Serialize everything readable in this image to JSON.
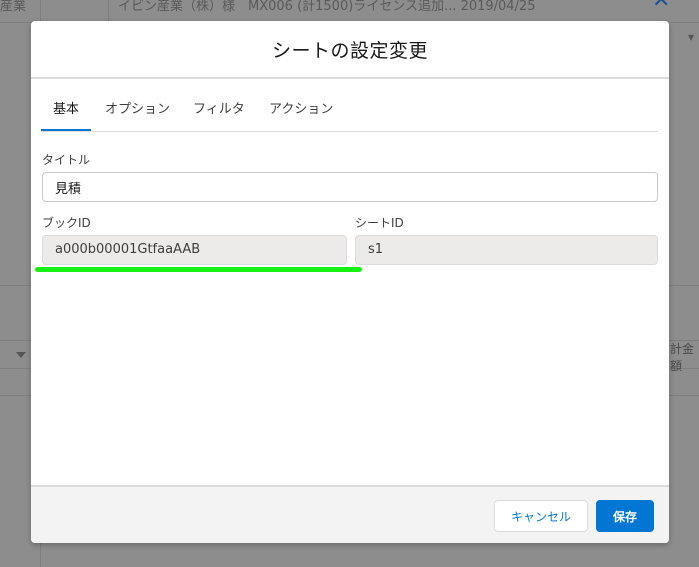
{
  "background": {
    "left_text": "産業",
    "record_text": "イビン産業（株）様　MX006 (計1500)ライセンス追加...  2019/04/25",
    "right_text": "計金額",
    "close_icon": "close-icon"
  },
  "modal": {
    "title": "シートの設定変更",
    "tabs": [
      {
        "label": "基本",
        "active": true
      },
      {
        "label": "オプション",
        "active": false
      },
      {
        "label": "フィルタ",
        "active": false
      },
      {
        "label": "アクション",
        "active": false
      }
    ],
    "fields": {
      "title_label": "タイトル",
      "title_value": "見積",
      "book_id_label": "ブックID",
      "book_id_value": "a000b00001GtfaaAAB",
      "sheet_id_label": "シートID",
      "sheet_id_value": "s1"
    },
    "footer": {
      "cancel_label": "キャンセル",
      "save_label": "保存"
    }
  },
  "colors": {
    "accent": "#0176d3",
    "highlight": "#16f014",
    "overlay": "#8d8d8d"
  }
}
